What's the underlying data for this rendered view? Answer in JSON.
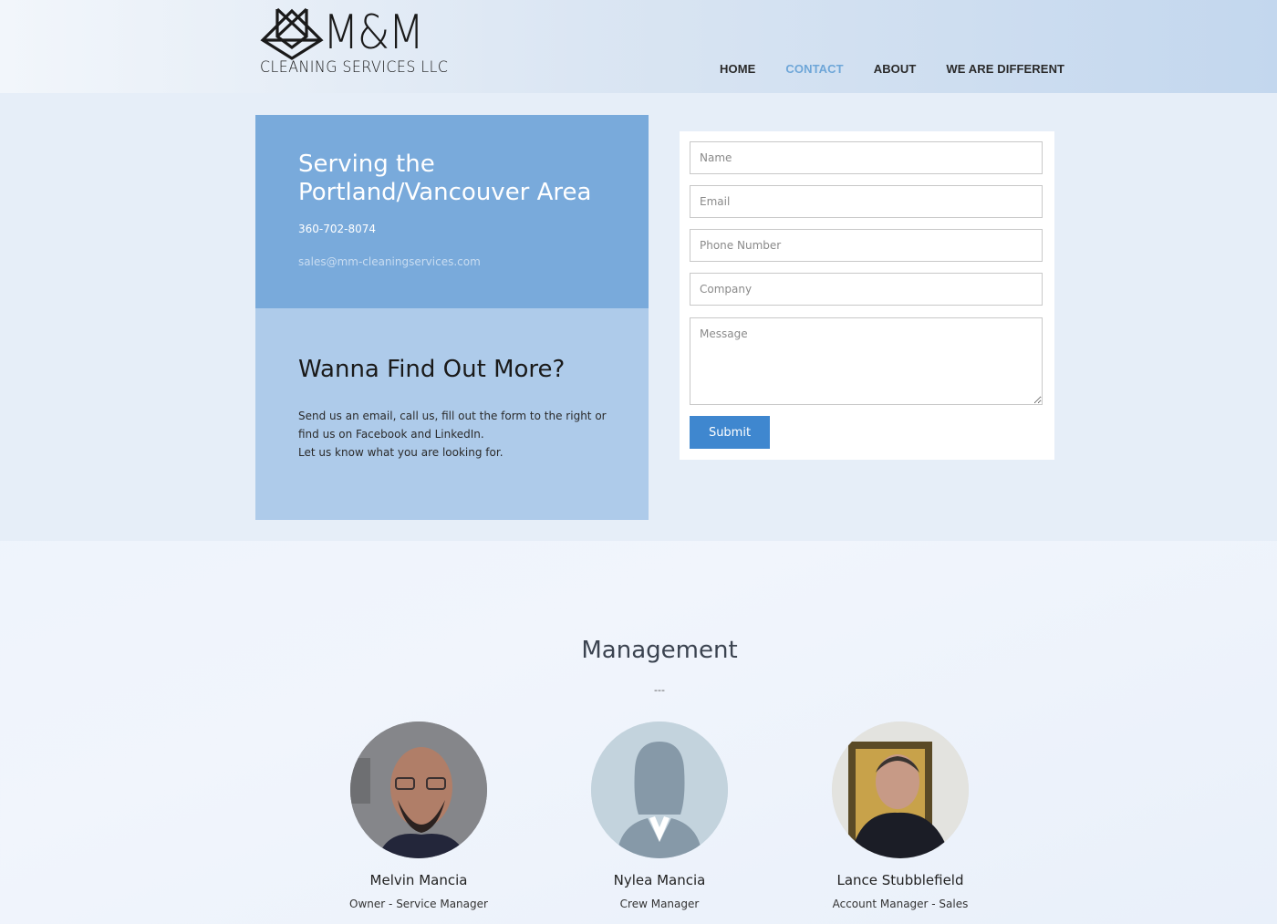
{
  "header": {
    "logo": {
      "brand": "M&M",
      "subtitle": "CLEANING SERVICES LLC"
    },
    "nav": [
      {
        "label": "HOME",
        "active": false
      },
      {
        "label": "CONTACT",
        "active": true
      },
      {
        "label": "ABOUT",
        "active": false
      },
      {
        "label": "WE ARE DIFFERENT",
        "active": false
      }
    ]
  },
  "contact": {
    "heading": "Serving the Portland/Vancouver Area",
    "phone": "360-702-8074",
    "email": "sales@mm-cleaningservices.com",
    "more_heading": "Wanna Find Out More?",
    "more_text_1": "Send us an email, call us, fill out the form to the right or find us on Facebook and LinkedIn.",
    "more_text_2": "Let us know what you are looking for."
  },
  "form": {
    "name_placeholder": "Name",
    "email_placeholder": "Email",
    "phone_placeholder": "Phone Number",
    "company_placeholder": "Company",
    "message_placeholder": "Message",
    "submit_label": "Submit"
  },
  "management": {
    "title": "Management",
    "divider": "---",
    "people": [
      {
        "name": "Melvin Mancia",
        "role": "Owner - Service Manager"
      },
      {
        "name": "Nylea Mancia",
        "role": "Crew Manager"
      },
      {
        "name": "Lance Stubblefield",
        "role": "Account Manager - Sales"
      }
    ]
  },
  "colors": {
    "nav_active": "#6ea6d8",
    "panel_top": "#79aadb",
    "panel_bottom": "#aecbea",
    "submit": "#3f87cf"
  }
}
